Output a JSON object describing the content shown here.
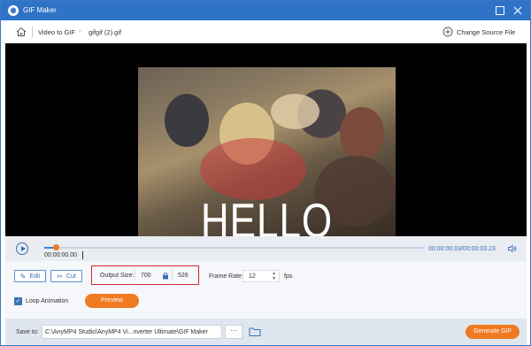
{
  "window": {
    "title": "GIF Maker",
    "brand_color": "#2f73c7",
    "accent_color": "#f07a21",
    "highlight_color": "#d0262b"
  },
  "breadcrumb": {
    "items": [
      "Video to GIF",
      "gifgif (2).gif"
    ],
    "change_source_label": "Change Source File"
  },
  "video": {
    "overlay_text": "HELLO"
  },
  "playback": {
    "current_time": "00:00:00.00",
    "time_display": "00:00:00.03/00:00:03.23",
    "progress": 0.01
  },
  "tools": {
    "edit_label": "Edit",
    "cut_label": "Cut"
  },
  "output_size": {
    "label": "Output Size:",
    "width": "700",
    "height": "526"
  },
  "frame_rate": {
    "label": "Frame Rate:",
    "value": "12",
    "unit": "fps"
  },
  "loop": {
    "label": "Loop Animation",
    "checked": true
  },
  "preview_label": "Preview",
  "footer": {
    "save_to_label": "Save to:",
    "path": "C:\\AnyMP4 Studio\\AnyMP4 Vi...nverter Ultimate\\GIF Maker",
    "browse_label": "···",
    "generate_label": "Generate GIF"
  },
  "icons": [
    "app-logo-icon",
    "maximize-icon",
    "close-icon",
    "home-icon",
    "chevron-right-icon",
    "plus-circle-icon",
    "play-icon",
    "volume-icon",
    "edit-icon",
    "scissors-icon",
    "lock-icon",
    "spinner-arrows-icon",
    "checkbox-icon",
    "folder-icon"
  ]
}
